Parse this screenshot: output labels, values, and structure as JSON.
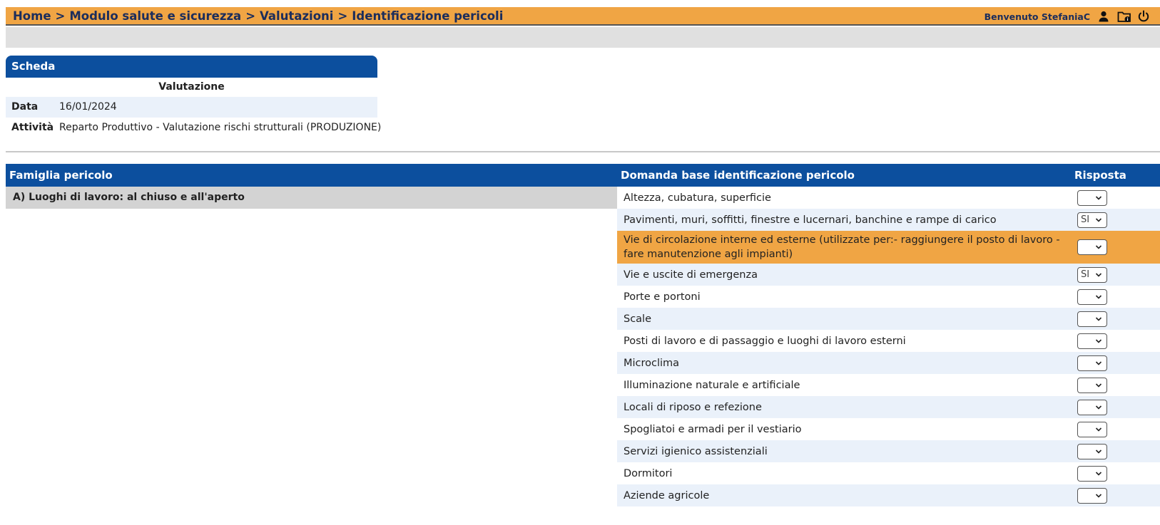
{
  "header": {
    "breadcrumb": [
      "Home",
      "Modulo salute e sicurezza",
      "Valutazioni",
      "Identificazione pericoli"
    ],
    "separator": ">",
    "welcome": "Benvenuto StefaniaC",
    "icons": [
      "user-icon",
      "folder-info-icon",
      "power-icon"
    ],
    "accent_color": "#f0a544",
    "text_color": "#1b2d5c"
  },
  "scheda": {
    "title": "Scheda",
    "subtitle": "Valutazione",
    "rows": [
      {
        "label": "Data",
        "value": "16/01/2024"
      },
      {
        "label": "Attività",
        "value": "Reparto Produttivo - Valutazione rischi strutturali (PRODUZIONE)"
      }
    ]
  },
  "table": {
    "headers": {
      "famiglia": "Famiglia pericolo",
      "domanda": "Domanda base identificazione pericolo",
      "risposta": "Risposta"
    },
    "header_color": "#0c4f9e",
    "famiglia": "A) Luoghi di lavoro: al chiuso e all'aperto",
    "rows": [
      {
        "question": "Altezza, cubatura, superficie",
        "answer": ""
      },
      {
        "question": "Pavimenti, muri, soffitti, finestre e lucernari, banchine e rampe di carico",
        "answer": "SI"
      },
      {
        "question": "Vie di circolazione interne ed esterne (utilizzate per:- raggiungere il posto di lavoro - fare manutenzione agli impianti)",
        "answer": "",
        "highlighted": true
      },
      {
        "question": "Vie e uscite di emergenza",
        "answer": "SI"
      },
      {
        "question": "Porte e portoni",
        "answer": ""
      },
      {
        "question": "Scale",
        "answer": ""
      },
      {
        "question": "Posti di lavoro e di passaggio e luoghi di lavoro esterni",
        "answer": ""
      },
      {
        "question": "Microclima",
        "answer": ""
      },
      {
        "question": "Illuminazione naturale e artificiale",
        "answer": ""
      },
      {
        "question": "Locali di riposo e refezione",
        "answer": ""
      },
      {
        "question": "Spogliatoi e armadi per il vestiario",
        "answer": ""
      },
      {
        "question": "Servizi igienico assistenziali",
        "answer": ""
      },
      {
        "question": "Dormitori",
        "answer": ""
      },
      {
        "question": "Aziende agricole",
        "answer": ""
      }
    ]
  }
}
